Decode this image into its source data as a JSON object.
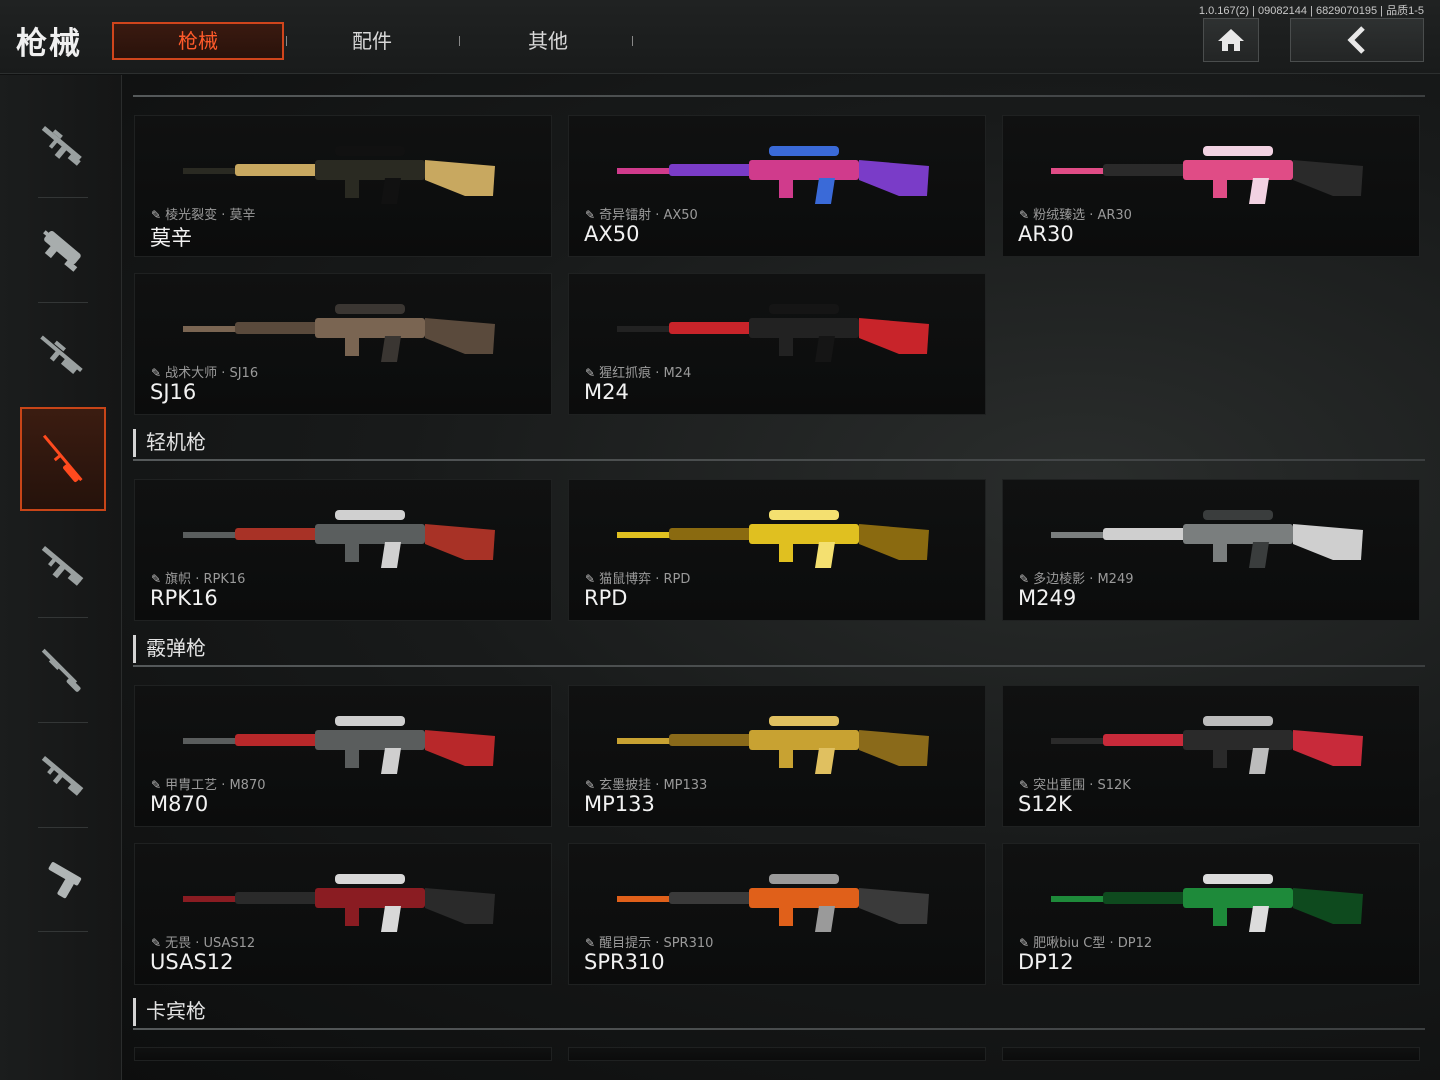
{
  "header": {
    "title": "枪械",
    "version": "1.0.167(2) | 09082144 | 6829070195 | 品质1-5",
    "tabs": [
      {
        "label": "枪械",
        "active": true
      },
      {
        "label": "配件",
        "active": false
      },
      {
        "label": "其他",
        "active": false
      }
    ],
    "home_icon": "home-icon",
    "back_icon": "chevron-left-icon"
  },
  "sidebar": {
    "items": [
      {
        "icon": "assault-rifle-icon",
        "active": false
      },
      {
        "icon": "smg-icon",
        "active": false
      },
      {
        "icon": "marksman-rifle-icon",
        "active": false
      },
      {
        "icon": "sniper-rifle-icon",
        "active": true
      },
      {
        "icon": "assault-rifle-2-icon",
        "active": false
      },
      {
        "icon": "shotgun-icon",
        "active": false
      },
      {
        "icon": "carbine-icon",
        "active": false
      },
      {
        "icon": "pistol-icon",
        "active": false
      }
    ]
  },
  "sections": {
    "lmg": "轻机枪",
    "shotgun": "霰弹枪",
    "carbine": "卡宾枪"
  },
  "cards": [
    {
      "skin": "棱光裂变 · 莫辛",
      "name": "莫辛",
      "colors": [
        "#2a2a22",
        "#c8a860",
        "#111111"
      ]
    },
    {
      "skin": "奇异镭射 · AX50",
      "name": "AX50",
      "colors": [
        "#d03b8c",
        "#7a3cc8",
        "#3a6ad8"
      ]
    },
    {
      "skin": "粉绒臻选 · AR30",
      "name": "AR30",
      "colors": [
        "#e04c86",
        "#2a2a2a",
        "#f2d2e2"
      ]
    },
    {
      "skin": "战术大师 · SJ16",
      "name": "SJ16",
      "colors": [
        "#7a6552",
        "#5a4a3c",
        "#3a3632"
      ]
    },
    {
      "skin": "猩红抓痕 · M24",
      "name": "M24",
      "colors": [
        "#222222",
        "#c8242a",
        "#151515"
      ]
    },
    {
      "skin": "旗帜 · RPK16",
      "name": "RPK16",
      "colors": [
        "#5a5e5e",
        "#a83226",
        "#d0d0d0"
      ]
    },
    {
      "skin": "猫鼠博弈 · RPD",
      "name": "RPD",
      "colors": [
        "#e0c020",
        "#8a6a10",
        "#f4e070"
      ]
    },
    {
      "skin": "多边棱影 · M249",
      "name": "M249",
      "colors": [
        "#7a7e7e",
        "#cfcfcf",
        "#3a3d3d"
      ]
    },
    {
      "skin": "甲胄工艺 · M870",
      "name": "M870",
      "colors": [
        "#5a5d5d",
        "#b8282a",
        "#cfcfcf"
      ]
    },
    {
      "skin": "玄墨披挂 · MP133",
      "name": "MP133",
      "colors": [
        "#c8a232",
        "#8a6a1a",
        "#e0c060"
      ]
    },
    {
      "skin": "突出重围 · S12K",
      "name": "S12K",
      "colors": [
        "#2a2a2a",
        "#c82a3a",
        "#bcbcbc"
      ]
    },
    {
      "skin": "无畏 · USAS12",
      "name": "USAS12",
      "colors": [
        "#8a1c22",
        "#2a2a2a",
        "#d8d8d8"
      ]
    },
    {
      "skin": "醒目提示 · SPR310",
      "name": "SPR310",
      "colors": [
        "#e0601a",
        "#3a3a3a",
        "#9a9a9a"
      ]
    },
    {
      "skin": "肥啾biu C型 · DP12",
      "name": "DP12",
      "colors": [
        "#1e8a3a",
        "#0e4a1e",
        "#dcdcdc"
      ]
    }
  ]
}
